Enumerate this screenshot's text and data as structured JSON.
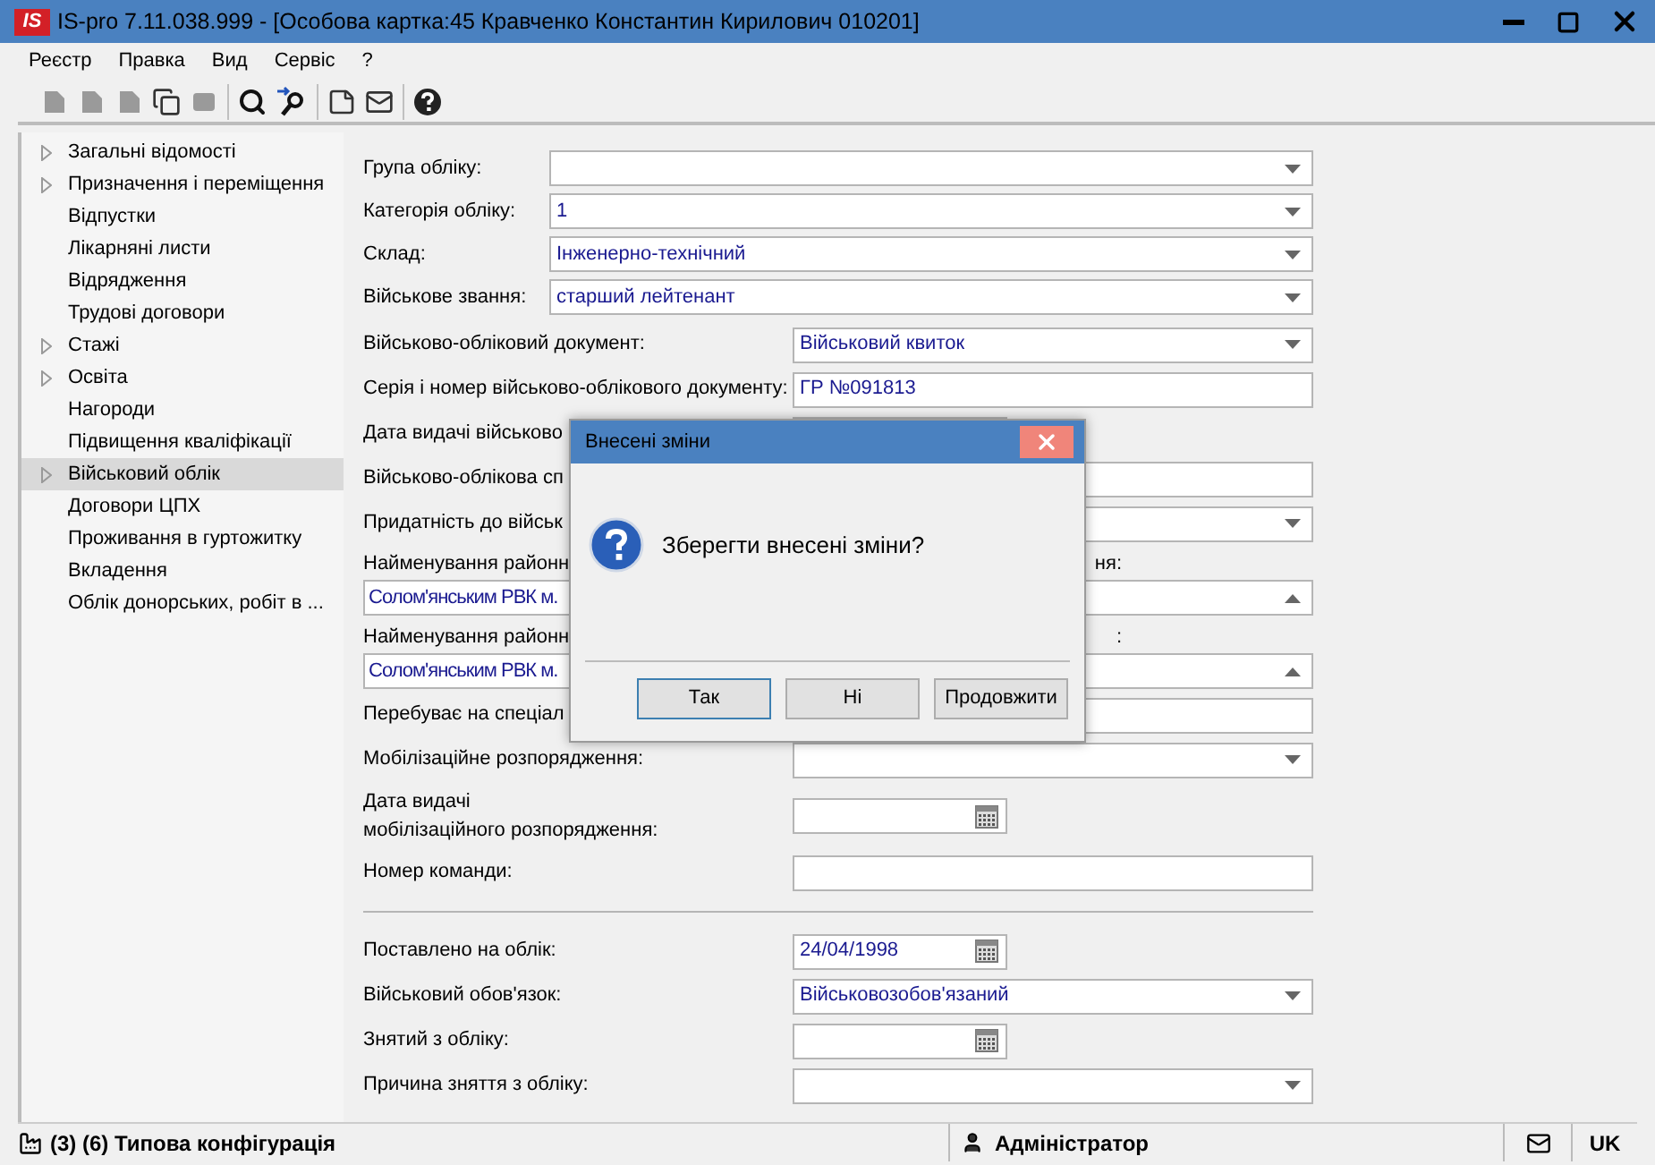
{
  "window": {
    "logo": "IS",
    "title": "IS-pro 7.11.038.999 - [Особова картка:45 Кравченко Константин Кирилович 010201]"
  },
  "menu": [
    "Реєстр",
    "Правка",
    "Вид",
    "Сервіс",
    "?"
  ],
  "sidebar": {
    "items": [
      {
        "label": "Загальні відомості",
        "expandable": true,
        "selected": false
      },
      {
        "label": "Призначення і переміщення",
        "expandable": true,
        "selected": false
      },
      {
        "label": "Відпустки",
        "expandable": false,
        "selected": false
      },
      {
        "label": "Лікарняні листи",
        "expandable": false,
        "selected": false
      },
      {
        "label": "Відрядження",
        "expandable": false,
        "selected": false
      },
      {
        "label": "Трудові договори",
        "expandable": false,
        "selected": false
      },
      {
        "label": "Стажі",
        "expandable": true,
        "selected": false
      },
      {
        "label": "Освіта",
        "expandable": true,
        "selected": false
      },
      {
        "label": "Нагороди",
        "expandable": false,
        "selected": false
      },
      {
        "label": "Підвищення кваліфікації",
        "expandable": false,
        "selected": false
      },
      {
        "label": "Військовий облік",
        "expandable": true,
        "selected": true
      },
      {
        "label": "Договори ЦПХ",
        "expandable": false,
        "selected": false
      },
      {
        "label": "Проживання в гуртожитку",
        "expandable": false,
        "selected": false
      },
      {
        "label": "Вкладення",
        "expandable": false,
        "selected": false
      },
      {
        "label": "Облік донорських, робіт в ...",
        "expandable": false,
        "selected": false
      }
    ]
  },
  "form": {
    "groups": [
      {
        "kind": "narrow",
        "fields": [
          {
            "kind": "select",
            "label": "Група обліку:"
          },
          {
            "kind": "select",
            "label": "Категорія обліку:",
            "value": "1"
          },
          {
            "kind": "select",
            "label": "Склад:",
            "value": "Інженерно-технічний"
          },
          {
            "kind": "select",
            "label": "Військове звання:",
            "value": "старший лейтенант"
          }
        ]
      },
      {
        "kind": "wide",
        "fields": [
          {
            "kind": "select",
            "label": "Військово-обліковий документ:",
            "value": "Військовий квиток"
          },
          {
            "kind": "text",
            "label": "Серія і номер військово-облікового документу:",
            "value": "ГР №091813"
          },
          {
            "kind": "short_box",
            "label": "Дата видачі військово"
          },
          {
            "kind": "text",
            "label": "Військово-облікова сп"
          },
          {
            "kind": "select",
            "label": "Придатність до військ"
          },
          {
            "kind": "combo_up",
            "label": "Найменування районн",
            "label_tail": "ня:",
            "value": "Солом'янським РВК м."
          },
          {
            "kind": "combo_up",
            "label": "Найменування районн",
            "label_tail": ":",
            "value": "Солом'янським РВК м."
          },
          {
            "kind": "text",
            "label": "Перебуває на спеціал"
          },
          {
            "kind": "select",
            "label": "Мобілізаційне розпорядження:"
          },
          {
            "kind": "date",
            "label": "Дата видачі\nмобілізаційного розпорядження:"
          },
          {
            "kind": "text",
            "label": "Номер команди:"
          },
          {
            "kind": "separator"
          },
          {
            "kind": "date",
            "label": "Поставлено на облік:",
            "value": "24/04/1998"
          },
          {
            "kind": "select",
            "label": "Військовий обов'язок:",
            "value": "Військовозобов'язаний"
          },
          {
            "kind": "date",
            "label": "Знятий з обліку:"
          },
          {
            "kind": "select",
            "label": "Причина зняття з обліку:"
          }
        ]
      }
    ]
  },
  "dialog": {
    "title": "Внесені зміни",
    "message": "Зберегти внесені зміни?",
    "buttons": [
      {
        "label": "Так",
        "default": true
      },
      {
        "label": "Ні",
        "default": false
      },
      {
        "label": "Продовжити",
        "default": false
      }
    ]
  },
  "status_bar": {
    "configuration": "(3) (6) Типова конфігурація",
    "user": "Адміністратор",
    "language": "UK"
  }
}
